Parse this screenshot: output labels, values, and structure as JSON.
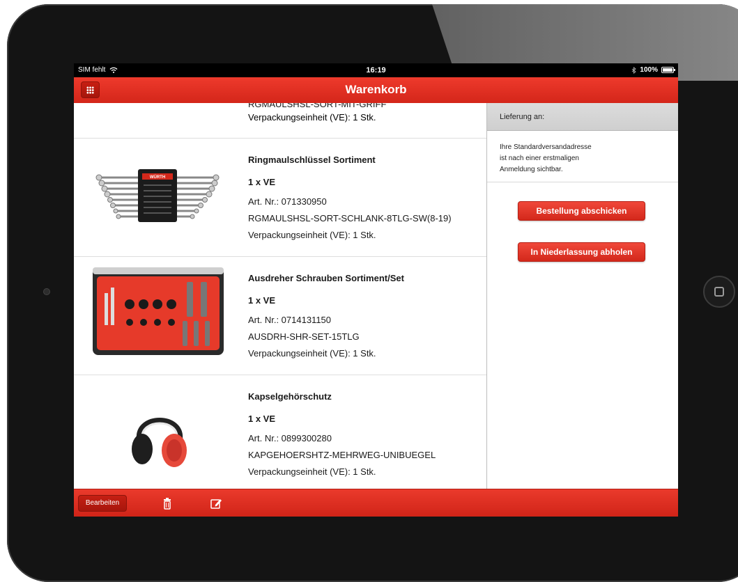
{
  "status_bar": {
    "carrier": "SIM fehlt",
    "time": "16:19",
    "battery": "100%"
  },
  "nav": {
    "title": "Warenkorb",
    "menu_icon": "grid-icon"
  },
  "cart": {
    "cutoff_top_line": "RGMAULSHSL-SORT-MIT-GRIFF",
    "cutoff_ve": "Verpackungseinheit (VE): 1 Stk.",
    "items": [
      {
        "name": "Ringmaulschlüssel Sortiment",
        "qty": "1 x VE",
        "art_nr": "Art. Nr.:  071330950",
        "code": "RGMAULSHSL-SORT-SCHLANK-8TLG-SW(8-19)",
        "ve": "Verpackungseinheit (VE): 1 Stk.",
        "image": "wrench-set-image",
        "brand": "WÜRTH"
      },
      {
        "name": "Ausdreher Schrauben Sortiment/Set",
        "qty": "1 x VE",
        "art_nr": "Art. Nr.:  0714131150",
        "code": "AUSDRH-SHR-SET-15TLG",
        "ve": "Verpackungseinheit (VE): 1 Stk.",
        "image": "screw-extractor-case-image"
      },
      {
        "name": "Kapselgehörschutz",
        "qty": "1 x VE",
        "art_nr": "Art. Nr.:  0899300280",
        "code": "KAPGEHOERSHTZ-MEHRWEG-UNIBUEGEL",
        "ve": "Verpackungseinheit (VE): 1 Stk.",
        "image": "ear-muffs-image"
      }
    ]
  },
  "delivery": {
    "header": "Lieferung an:",
    "note_line1": "Ihre Standardversandadresse",
    "note_line2": "ist nach einer erstmaligen",
    "note_line3": "Anmeldung sichtbar.",
    "submit_button": "Bestellung abschicken",
    "pickup_button": "In Niederlassung abholen"
  },
  "toolbar": {
    "edit_button": "Bearbeiten",
    "delete_icon": "trash-icon",
    "compose_icon": "compose-icon"
  },
  "colors": {
    "brand_red": "#e0301f",
    "device_frame": "#141414"
  }
}
